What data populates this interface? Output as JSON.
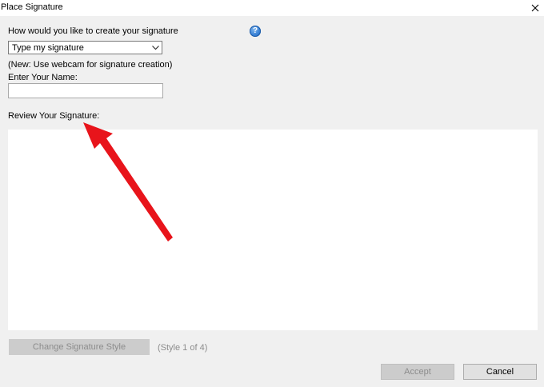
{
  "window": {
    "title": "Place Signature"
  },
  "form": {
    "create_prompt": "How would you like to create your signature",
    "method_selected": "Type my signature",
    "webcam_note": "(New: Use webcam for signature creation)",
    "name_label": "Enter Your Name:",
    "name_value": "",
    "review_label": "Review Your Signature:"
  },
  "style": {
    "change_button": "Change Signature Style",
    "counter": "(Style 1 of 4)"
  },
  "footer": {
    "accept_label": "Accept",
    "cancel_label": "Cancel"
  },
  "colors": {
    "annotation_arrow": "#e8141b",
    "help_icon": "#3a82d6"
  }
}
